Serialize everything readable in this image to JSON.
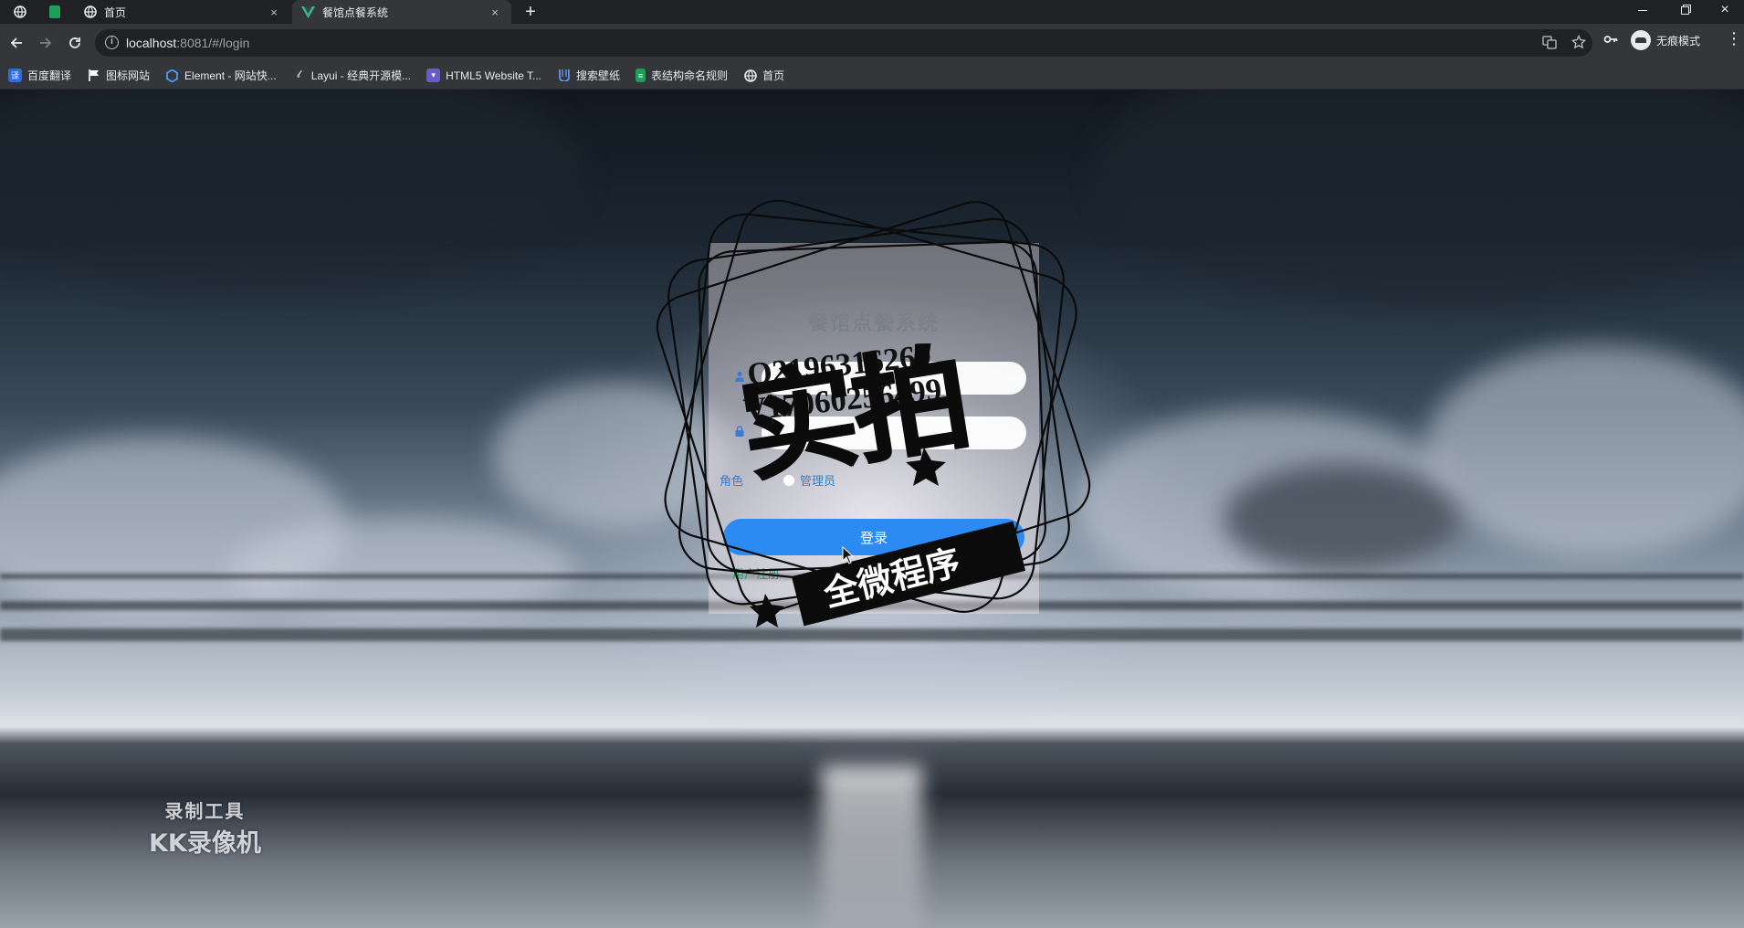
{
  "browser": {
    "tabs": [
      {
        "title": "首页",
        "active": false
      },
      {
        "title": "餐馆点餐系统",
        "active": true
      }
    ],
    "url_host": "localhost",
    "url_path": ":8081/#/login",
    "close_glyph": "×",
    "new_tab_glyph": "+",
    "incognito_label": "无痕模式"
  },
  "bookmarks": [
    {
      "label": "百度翻译",
      "icon": "baidu-translate-icon",
      "color": "#2a6bf2"
    },
    {
      "label": "图标网站",
      "icon": "flag-icon",
      "color": "#ffffff"
    },
    {
      "label": "Element - 网站快...",
      "icon": "element-hex-icon",
      "color": "#409eff"
    },
    {
      "label": "Layui - 经典开源模...",
      "icon": "layui-icon",
      "color": "#cccccc"
    },
    {
      "label": "HTML5 Website T...",
      "icon": "html5-icon",
      "color": "#6a5acd"
    },
    {
      "label": "搜索壁纸",
      "icon": "wallpaper-icon",
      "color": "#3a7bd5"
    },
    {
      "label": "表结构命名规则",
      "icon": "sheet-icon",
      "color": "#1e9e58"
    },
    {
      "label": "首页",
      "icon": "globe-icon",
      "color": "#e8eaed"
    }
  ],
  "login": {
    "title": "餐馆点餐系统",
    "role_label": "角色",
    "role_option": "管理员",
    "submit_label": "登录",
    "register_label": "用户注册"
  },
  "watermark": {
    "contact_line1": "Q2196316269",
    "contact_line2": "V17060256499",
    "stamp_big": "实拍",
    "stamp_ribbon": "全微程序",
    "recorder_line1": "录制工具",
    "recorder_line2": "KK录像机"
  }
}
